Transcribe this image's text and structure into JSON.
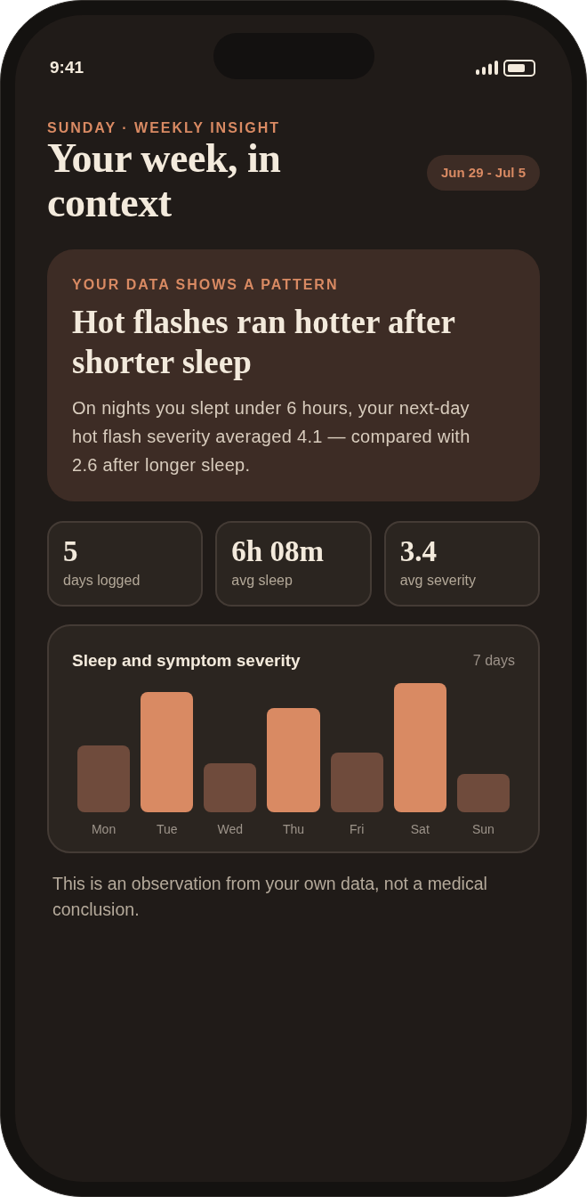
{
  "status_bar": {
    "time": "9:41"
  },
  "header": {
    "eyebrow": "SUNDAY · WEEKLY INSIGHT",
    "title": "Your week, in context",
    "date_range": "Jun 29 - Jul 5"
  },
  "insight": {
    "eyebrow": "YOUR DATA SHOWS A PATTERN",
    "headline": "Hot flashes ran hotter after shorter sleep",
    "body": "On nights you slept under 6 hours, your next-day hot flash severity averaged 4.1 — compared with 2.6 after longer sleep."
  },
  "stats": [
    {
      "value": "5",
      "label": "days logged"
    },
    {
      "value": "6h 08m",
      "label": "avg sleep"
    },
    {
      "value": "3.4",
      "label": "avg severity"
    }
  ],
  "chart": {
    "title": "Sleep and symptom severity",
    "range": "7 days",
    "days": [
      {
        "label": "Mon",
        "highlighted": false
      },
      {
        "label": "Tue",
        "highlighted": true
      },
      {
        "label": "Wed",
        "highlighted": false
      },
      {
        "label": "Thu",
        "highlighted": true
      },
      {
        "label": "Fri",
        "highlighted": false
      },
      {
        "label": "Sat",
        "highlighted": true
      },
      {
        "label": "Sun",
        "highlighted": false
      }
    ]
  },
  "disclaimer": "This is an observation from your own data, not a medical conclusion."
}
